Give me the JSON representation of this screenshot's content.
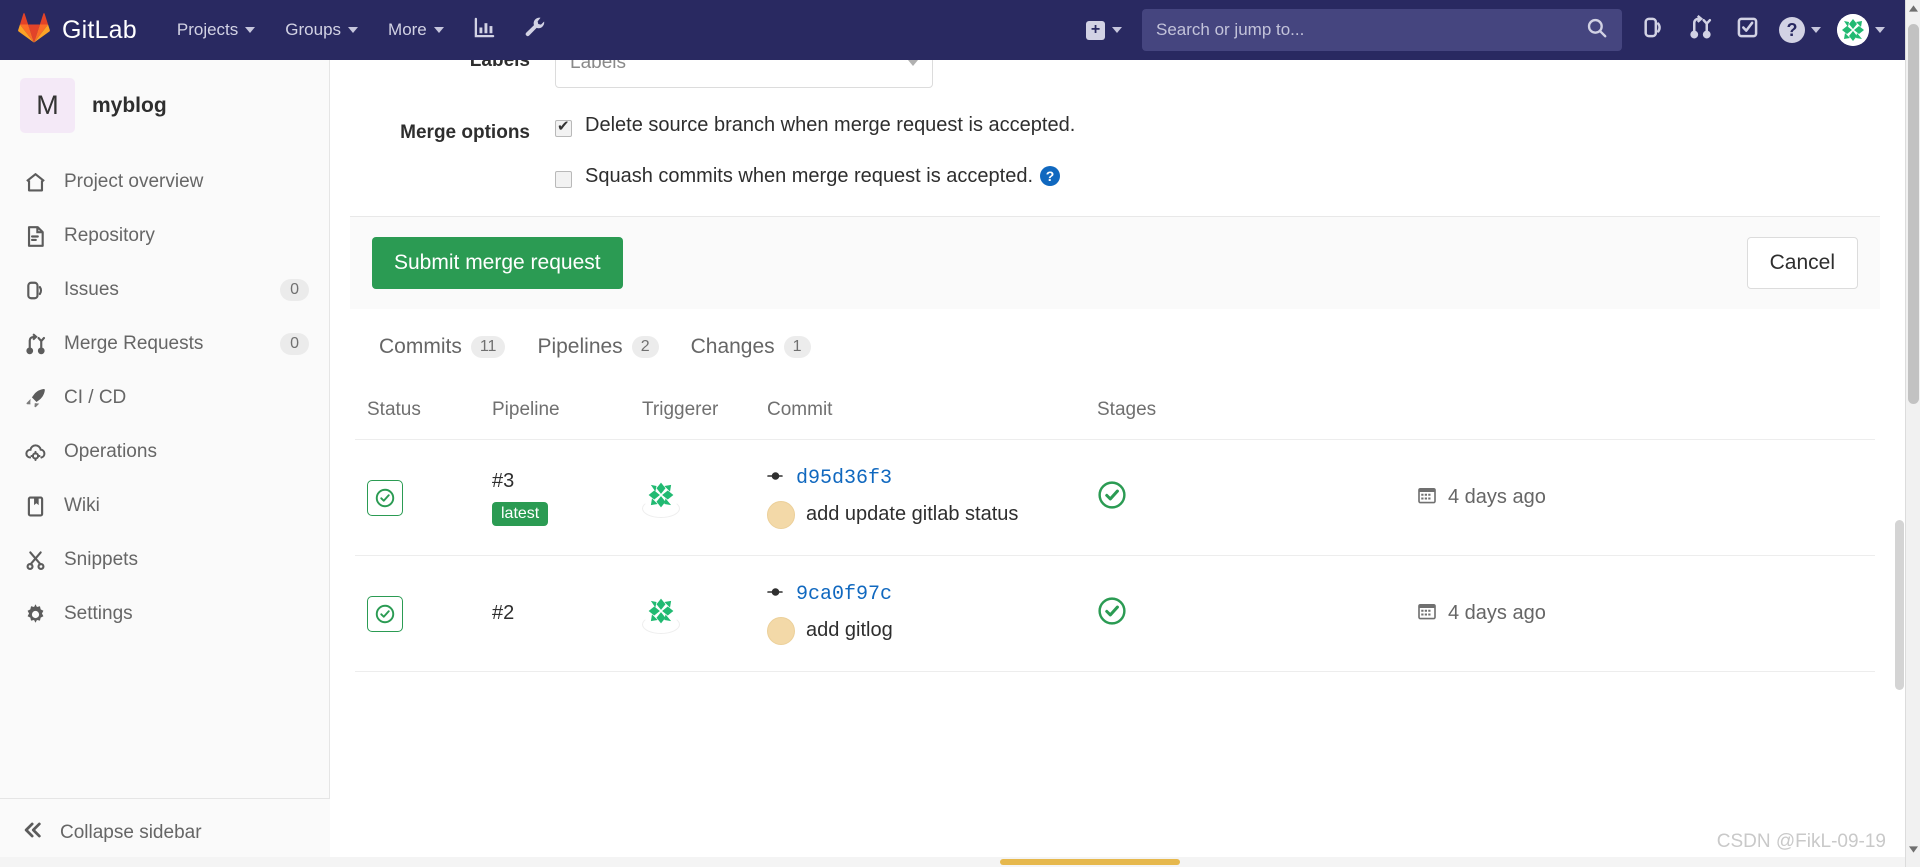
{
  "navbar": {
    "brand": "GitLab",
    "links": [
      {
        "label": "Projects",
        "name": "projects"
      },
      {
        "label": "Groups",
        "name": "groups"
      },
      {
        "label": "More",
        "name": "more"
      }
    ],
    "icon_buttons": [
      {
        "name": "analytics-icon"
      },
      {
        "name": "wrench-icon"
      }
    ],
    "create_new_label": "+",
    "search": {
      "placeholder": "Search or jump to...",
      "value": ""
    },
    "right_icons": [
      {
        "name": "issues-icon"
      },
      {
        "name": "merge-requests-icon"
      },
      {
        "name": "todos-icon"
      },
      {
        "name": "help-icon"
      },
      {
        "name": "user-avatar"
      }
    ]
  },
  "sidebar": {
    "project": {
      "initial": "M",
      "name": "myblog"
    },
    "items": [
      {
        "label": "Project overview",
        "icon": "home-icon",
        "count": ""
      },
      {
        "label": "Repository",
        "icon": "document-icon",
        "count": ""
      },
      {
        "label": "Issues",
        "icon": "issues-icon",
        "count": "0"
      },
      {
        "label": "Merge Requests",
        "icon": "merge-requests-icon",
        "count": "0"
      },
      {
        "label": "CI / CD",
        "icon": "rocket-icon",
        "count": ""
      },
      {
        "label": "Operations",
        "icon": "cloud-gear-icon",
        "count": ""
      },
      {
        "label": "Wiki",
        "icon": "book-icon",
        "count": ""
      },
      {
        "label": "Snippets",
        "icon": "scissors-icon",
        "count": ""
      },
      {
        "label": "Settings",
        "icon": "gear-icon",
        "count": ""
      }
    ],
    "collapse": {
      "label": "Collapse sidebar",
      "icon": "double-chevron-left-icon"
    }
  },
  "form": {
    "labels_field": {
      "label": "Labels",
      "placeholder": "Labels",
      "value": ""
    },
    "merge_options_label": "Merge options",
    "options": [
      {
        "text": "Delete source branch when merge request is accepted.",
        "checked": true,
        "help": false
      },
      {
        "text": "Squash commits when merge request is accepted.",
        "checked": false,
        "help": true
      }
    ],
    "submit_label": "Submit merge request",
    "cancel_label": "Cancel",
    "submit_color": "#2b9b53"
  },
  "tabs": [
    {
      "label": "Commits",
      "count": "11"
    },
    {
      "label": "Pipelines",
      "count": "2"
    },
    {
      "label": "Changes",
      "count": "1"
    }
  ],
  "pipelines_table": {
    "columns": [
      "Status",
      "Pipeline",
      "Triggerer",
      "Commit",
      "Stages",
      ""
    ],
    "rows": [
      {
        "status_icon": "status-passed-icon",
        "pipeline_id": "#3",
        "latest_badge": "latest",
        "triggerer_avatar": "user-avatar",
        "commit_hash": "d95d36f3",
        "commit_message": "add update gitlab status",
        "stage_icon": "stage-passed-icon",
        "date": "4 days ago"
      },
      {
        "status_icon": "status-passed-icon",
        "pipeline_id": "#2",
        "latest_badge": "",
        "triggerer_avatar": "user-avatar",
        "commit_hash": "9ca0f97c",
        "commit_message": "add gitlog",
        "stage_icon": "stage-passed-icon",
        "date": "4 days ago"
      }
    ]
  },
  "watermark": "CSDN @FikL-09-19",
  "colors": {
    "navbar_bg": "#292961",
    "success_green": "#2b9b53",
    "link_blue": "#1068bf"
  }
}
